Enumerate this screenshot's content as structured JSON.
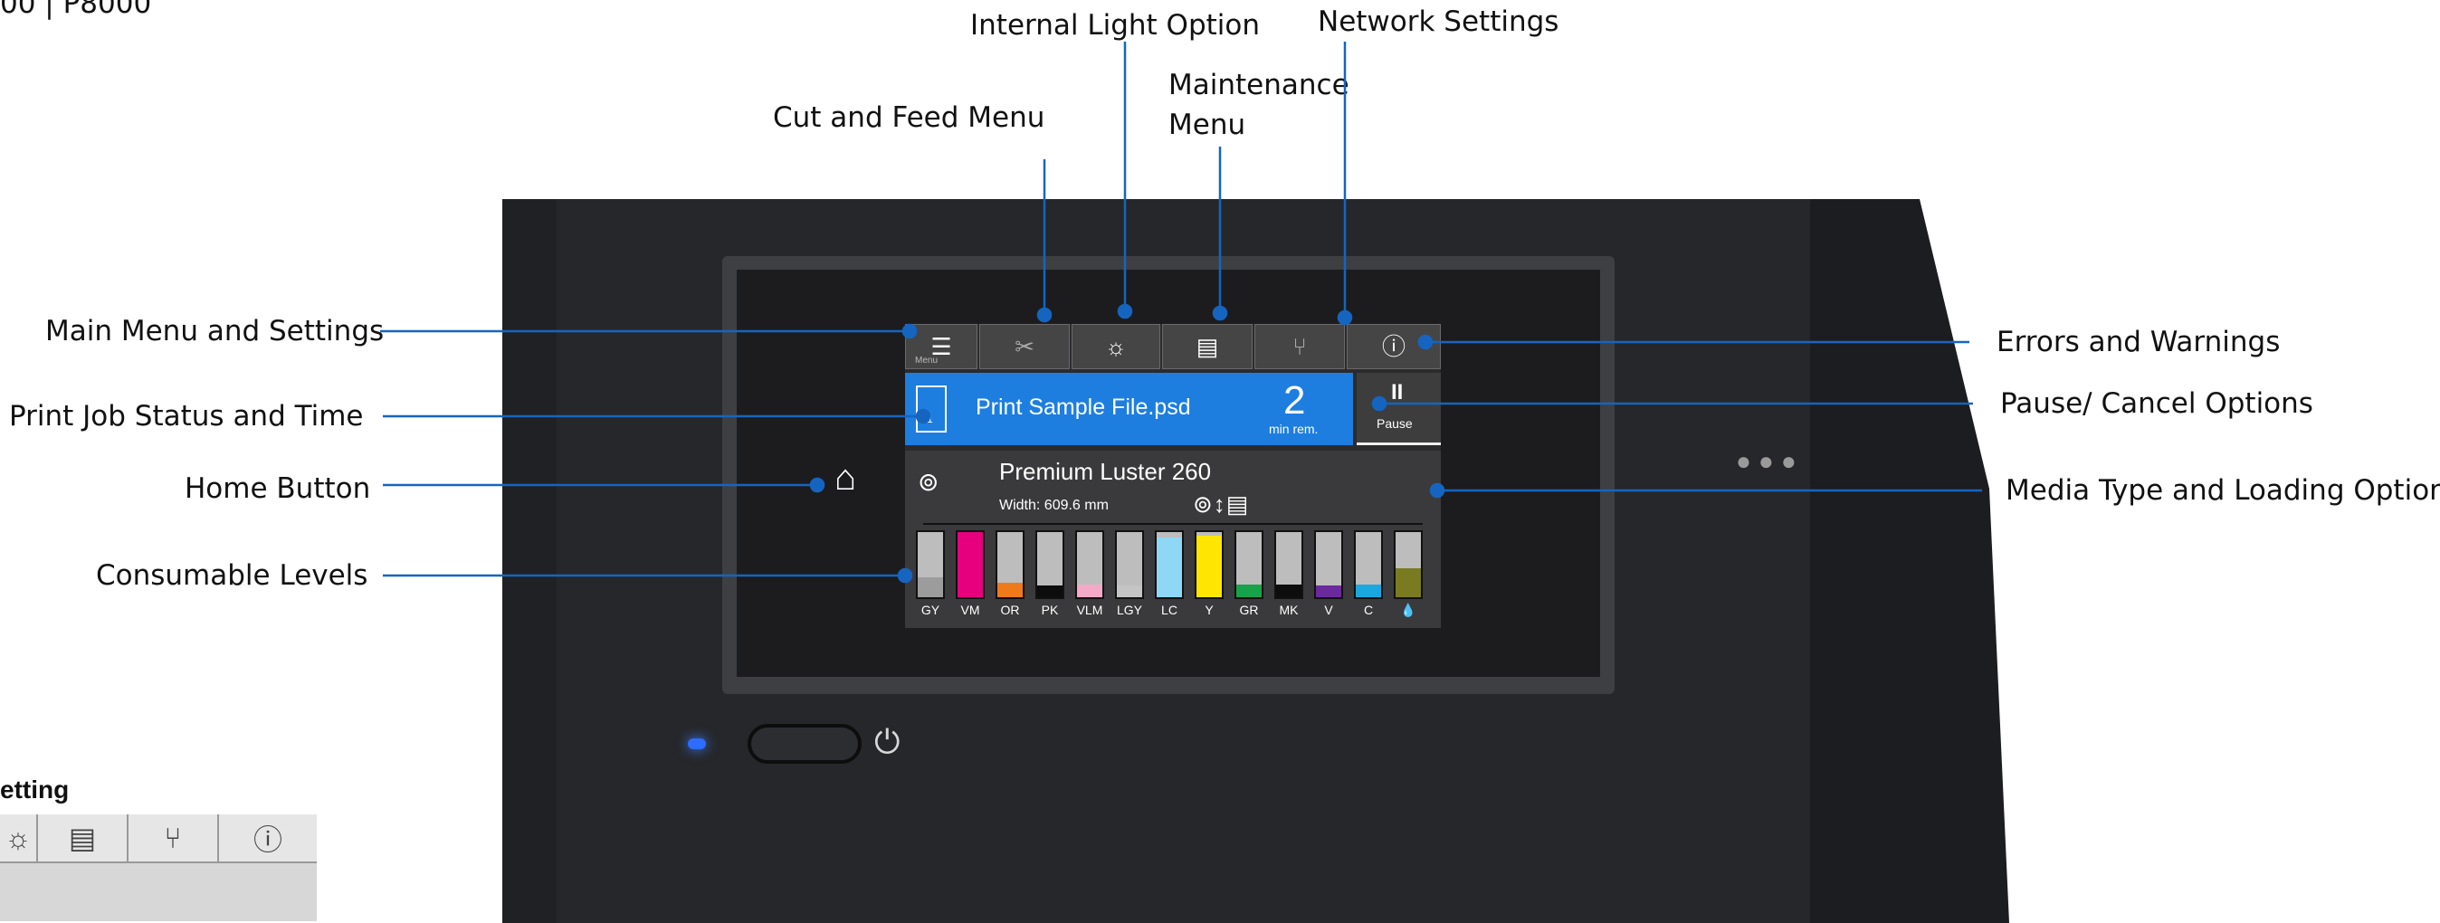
{
  "corner_text": "00 | P8000",
  "labels": {
    "internal_light": "Internal Light Option",
    "network": "Network Settings",
    "maintenance_1": "Maintenance",
    "maintenance_2": "Menu",
    "cut_feed": "Cut and Feed Menu",
    "main_menu": "Main Menu and Settings",
    "print_job": "Print Job Status and Time",
    "home": "Home Button",
    "consumables": "Consumable Levels",
    "errors": "Errors and Warnings",
    "pause": "Pause/ Cancel Options",
    "media": "Media Type and Loading Options"
  },
  "screen": {
    "menu_caption": "Menu",
    "job_file": "Print Sample File.psd",
    "job_icon_number": "1",
    "job_remaining": "2",
    "job_remaining_unit": "min rem.",
    "pause_label": "Pause",
    "media_name": "Premium Luster 260",
    "media_width": "Width: 609.6 mm",
    "icons": [
      "menu-icon",
      "scissors-icon",
      "light-icon",
      "maintenance-icon",
      "network-icon",
      "info-icon"
    ]
  },
  "inks": [
    {
      "label": "GY",
      "level": 0.3,
      "color": "#9c9c9c"
    },
    {
      "label": "VM",
      "level": 1.0,
      "color": "#e6007e"
    },
    {
      "label": "OR",
      "level": 0.22,
      "color": "#ef7a1a"
    },
    {
      "label": "PK",
      "level": 0.18,
      "color": "#0d0d0d"
    },
    {
      "label": "VLM",
      "level": 0.2,
      "color": "#f4a9c8"
    },
    {
      "label": "LGY",
      "level": 0.18,
      "color": "#c4c4c4"
    },
    {
      "label": "LC",
      "level": 0.92,
      "color": "#8fd8f5"
    },
    {
      "label": "Y",
      "level": 0.95,
      "color": "#ffe600"
    },
    {
      "label": "GR",
      "level": 0.2,
      "color": "#17a34a"
    },
    {
      "label": "MK",
      "level": 0.2,
      "color": "#0d0d0d"
    },
    {
      "label": "V",
      "level": 0.18,
      "color": "#6a2a9b"
    },
    {
      "label": "C",
      "level": 0.2,
      "color": "#1aa7e0"
    },
    {
      "label": "maintenance-box",
      "level": 0.45,
      "color": "#7a7a20"
    }
  ],
  "bottom_left": {
    "title": "etting"
  },
  "colors": {
    "callout_line": "#1565c0",
    "screen_blue": "#1d7ee0",
    "led_blue": "#2d6cff"
  }
}
